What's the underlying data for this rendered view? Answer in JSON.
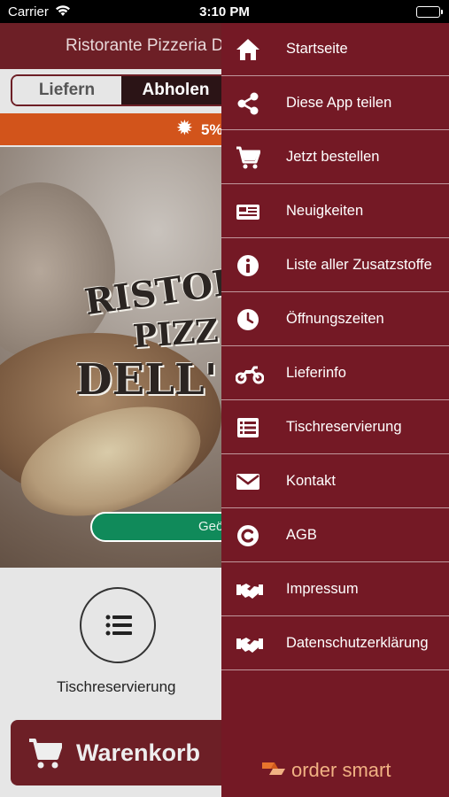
{
  "status_bar": {
    "carrier": "Carrier",
    "time": "3:10 PM"
  },
  "app": {
    "title": "Ristorante Pizzeria D",
    "toggle": {
      "liefern": "Liefern",
      "abholen": "Abholen"
    },
    "promo": {
      "text": "5%"
    },
    "hero_logo": {
      "line1": "RISTOR",
      "line2": "PIZZ",
      "line3": "DELL'"
    },
    "open_badge": "Geö",
    "reserve_label": "Tischreservierung",
    "cart_label": "Warenkorb"
  },
  "drawer": {
    "items": [
      {
        "label": "Startseite",
        "icon": "home-icon"
      },
      {
        "label": "Diese App teilen",
        "icon": "share-icon"
      },
      {
        "label": "Jetzt bestellen",
        "icon": "cart-icon"
      },
      {
        "label": "Neuigkeiten",
        "icon": "news-icon"
      },
      {
        "label": "Liste aller Zusatzstoffe",
        "icon": "info-icon"
      },
      {
        "label": "Öffnungszeiten",
        "icon": "clock-icon"
      },
      {
        "label": "Lieferinfo",
        "icon": "motorcycle-icon"
      },
      {
        "label": "Tischreservierung",
        "icon": "list-icon"
      },
      {
        "label": "Kontakt",
        "icon": "envelope-icon"
      },
      {
        "label": "AGB",
        "icon": "copyright-icon"
      },
      {
        "label": "Impressum",
        "icon": "handshake-icon"
      },
      {
        "label": "Datenschutzerklärung",
        "icon": "handshake-icon"
      }
    ],
    "brand": "order smart"
  },
  "colors": {
    "drawer_bg": "#741925",
    "header_bg": "#6d1f26",
    "promo_bg": "#d2541b",
    "open_badge": "#108a5a",
    "brand": "#f0b183"
  }
}
